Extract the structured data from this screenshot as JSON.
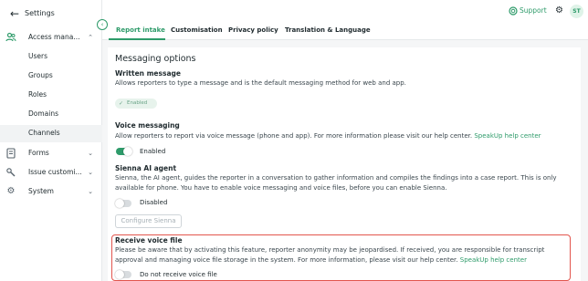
{
  "sidebar": {
    "back_label": "Settings",
    "items": [
      {
        "label": "Access mana...",
        "icon": "users-icon"
      },
      {
        "label": "Forms",
        "icon": "form-icon"
      },
      {
        "label": "Issue customi...",
        "icon": "tools-icon"
      },
      {
        "label": "System",
        "icon": "gear-icon"
      }
    ],
    "subitems": [
      "Users",
      "Groups",
      "Roles",
      "Domains",
      "Channels"
    ]
  },
  "header": {
    "support_label": "Support",
    "avatar_initials": "ST"
  },
  "tabs": [
    "Report intake",
    "Customisation",
    "Privacy policy",
    "Translation & Language"
  ],
  "main": {
    "section_title": "Messaging options",
    "written": {
      "title": "Written message",
      "description": "Allows reporters to type a message and is the default messaging method for web and app.",
      "chip_label": "Enabled"
    },
    "voice": {
      "title": "Voice messaging",
      "description": "Allow reporters to report via voice message (phone and app). For more information please visit our help center.",
      "link": "SpeakUp help center",
      "toggle_label": "Enabled",
      "toggle_on": true
    },
    "sienna": {
      "title": "Sienna AI agent",
      "description": "Sienna, the AI agent, guides the reporter in a conversation to gather information and compiles the findings into a case report. This is only available for phone. You have to enable voice messaging and voice files, before you can enable Sienna.",
      "toggle_label": "Disabled",
      "toggle_on": false,
      "button_label": "Configure Sienna"
    },
    "receive_voice": {
      "title": "Receive voice file",
      "description": "Please be aware that by activating this feature, reporter anonymity may be jeopardised. If received, you are responsible for transcript approval and managing voice file storage in the system. For more information, please visit our help center.",
      "link": "SpeakUp help center",
      "toggle_label": "Do not receive voice file",
      "toggle_on": false
    }
  },
  "colors": {
    "accent": "#2e9b6a",
    "highlight_border": "#e2554d"
  }
}
